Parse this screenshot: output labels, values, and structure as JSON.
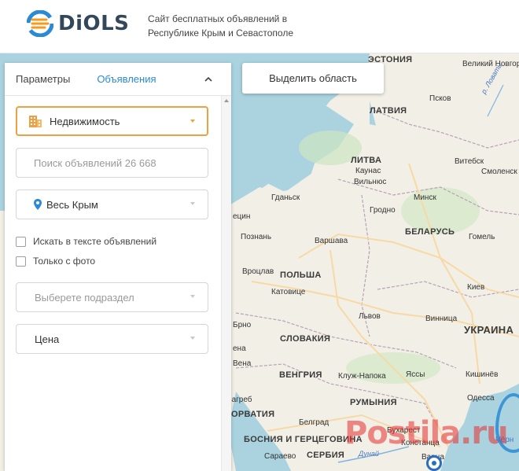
{
  "header": {
    "logo_text": "DiOLS",
    "tagline_line1": "Сайт бесплатных объявлений в",
    "tagline_line2": "Республике Крым и Севастополе"
  },
  "panel": {
    "tab_params": "Параметры",
    "tab_ads": "Объявления",
    "category": "Недвижимость",
    "search_placeholder": "Поиск объявлений 26 668",
    "location": "Весь Крым",
    "check_search_text": "Искать в тексте объявлений",
    "check_only_photo": "Только с фото",
    "subsection_placeholder": "Выберете подраздел",
    "price_label": "Цена"
  },
  "map_controls": {
    "select_area_label": "Выделить область"
  },
  "map": {
    "labels": {
      "estonia": "ЭСТОНИЯ",
      "veliky_novgorod": "Великий Новгород",
      "pskov": "Псков",
      "lovat": "р. Ловать",
      "latvia": "ЛАТВИЯ",
      "vitebsk": "Витебск",
      "smolensk": "Смоленск",
      "lithuania": "ЛИТВА",
      "kaunas": "Каунас",
      "vilnius": "Вильнюс",
      "gdansk": "Гданьск",
      "minsk": "Минск",
      "grodno": "Гродно",
      "szczecin": "ецин",
      "poznan": "Познань",
      "warsaw": "Варшава",
      "belarus": "БЕЛАРУСЬ",
      "gomel": "Гомель",
      "wroclaw": "Вроцлав",
      "poland": "ПОЛЬША",
      "katowice": "Катовице",
      "kyiv": "Киев",
      "lviv": "Львов",
      "vinnytsia": "Винница",
      "ukraine": "УКРАИНА",
      "brno": "Брно",
      "slovakia": "СЛОВАКИЯ",
      "vienna": "ена",
      "vena": "Вена",
      "hungary": "ВЕНГРИЯ",
      "cluj": "Клуж-Напока",
      "iasi": "Яссы",
      "chisinau": "Кишинёв",
      "odessa": "Одесса",
      "romania": "РУМЫНИЯ",
      "zagreb": "загреб",
      "croatia": "ОРВАТИЯ",
      "belgrade": "Белград",
      "bucharest": "Бухарест",
      "constanta": "Констанца",
      "bosnia": "БОСНИЯ И ГЕРЦЕГОВИНА",
      "sarajevo": "Сараево",
      "serbia": "СЕРБИЯ",
      "danube": "Дунай",
      "varna": "Варна",
      "chernoe": "Чёрн"
    }
  },
  "watermark": "Postila.ru"
}
